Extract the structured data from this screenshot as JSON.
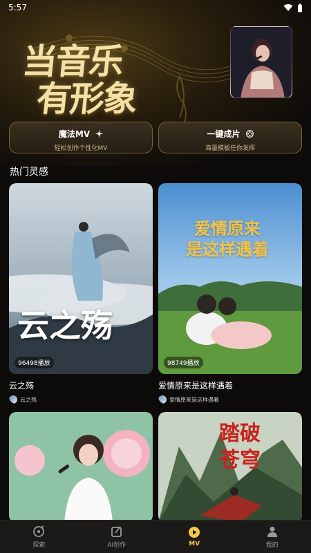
{
  "status": {
    "time": "5:57"
  },
  "hero": {
    "title_line1": "当音乐",
    "title_line2": "有形象"
  },
  "features": [
    {
      "title": "魔法MV",
      "subtitle": "轻松创作个性化MV",
      "icon": "sparkle-icon"
    },
    {
      "title": "一键成片",
      "subtitle": "海量模板任你发挥",
      "icon": "film-reel-icon"
    }
  ],
  "section": {
    "title": "热门灵感"
  },
  "cards": [
    {
      "plays": "96498播放",
      "title": "云之殇",
      "author": "云之殇",
      "art_text": "云之殇"
    },
    {
      "plays": "98749播放",
      "title": "爱情原来是这样遇着",
      "author": "爱情原来是这样遇着",
      "art_line1": "爱情原来",
      "art_line2": "是这样遇着"
    },
    {
      "plays": "",
      "title": "",
      "author": ""
    },
    {
      "plays": "",
      "title": "",
      "author": "",
      "art_line1": "踏破",
      "art_line2": "苍穹"
    }
  ],
  "tabs": [
    {
      "label": "探索",
      "icon": "explore-icon",
      "active": false
    },
    {
      "label": "AI创作",
      "icon": "ai-create-icon",
      "active": false
    },
    {
      "label": "MV",
      "icon": "mv-play-icon",
      "active": true
    },
    {
      "label": "我的",
      "icon": "profile-icon",
      "active": false
    }
  ],
  "colors": {
    "accent": "#f3c84c",
    "gold_border": "#7a6230",
    "background": "#0d0b0a"
  }
}
